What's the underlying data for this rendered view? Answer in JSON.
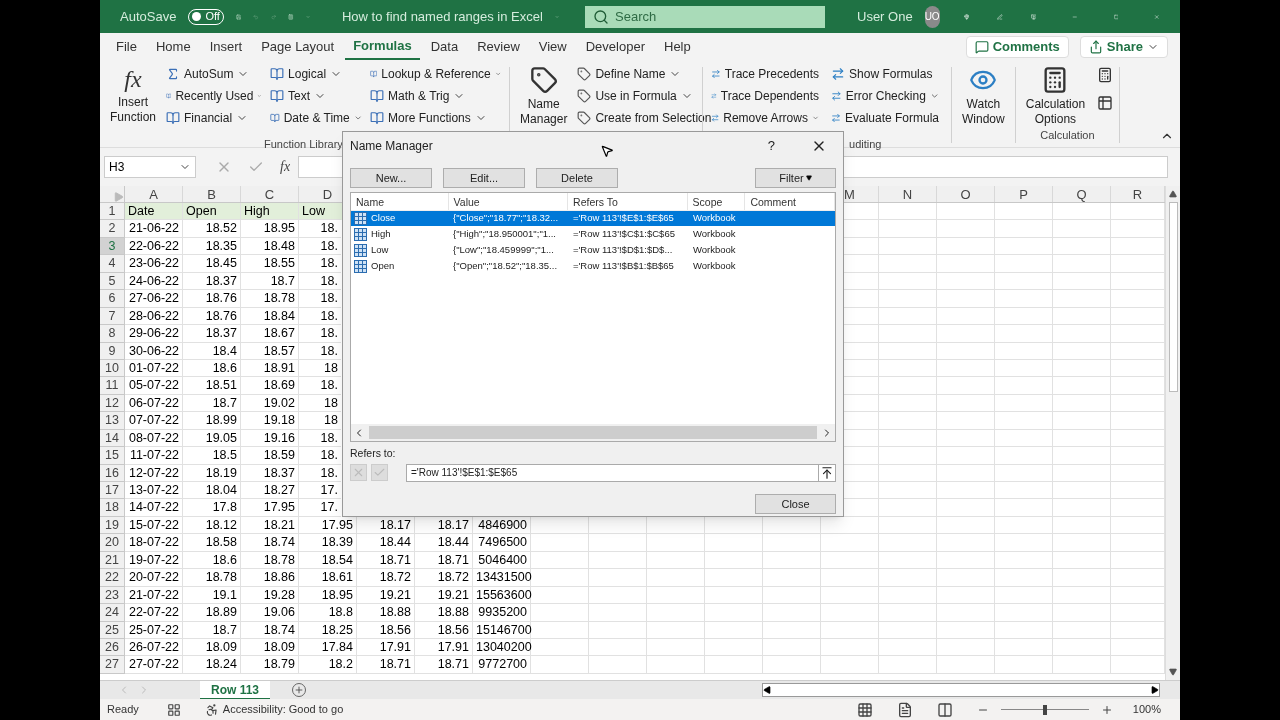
{
  "title_bar": {
    "autosave_label": "AutoSave",
    "autosave_on": false,
    "autosave_state": "Off",
    "document_title": "How to find named ranges in Excel",
    "search_placeholder": "Search",
    "user_name": "User One",
    "user_initials": "UO"
  },
  "menu_tabs": [
    {
      "label": "File",
      "selected": false
    },
    {
      "label": "Home",
      "selected": false
    },
    {
      "label": "Insert",
      "selected": false
    },
    {
      "label": "Page Layout",
      "selected": false
    },
    {
      "label": "Formulas",
      "selected": true
    },
    {
      "label": "Data",
      "selected": false
    },
    {
      "label": "Review",
      "selected": false
    },
    {
      "label": "View",
      "selected": false
    },
    {
      "label": "Developer",
      "selected": false
    },
    {
      "label": "Help",
      "selected": false
    }
  ],
  "comments_button": "Comments",
  "share_button": "Share",
  "ribbon": {
    "insert_function_glyph": "fx",
    "insert_function": [
      "Insert",
      "Function"
    ],
    "function_library": {
      "columns": [
        [
          {
            "label": "AutoSum",
            "dropdown": true
          },
          {
            "label": "Recently Used",
            "dropdown": true
          },
          {
            "label": "Financial",
            "dropdown": true
          }
        ],
        [
          {
            "label": "Logical",
            "dropdown": true
          },
          {
            "label": "Text",
            "dropdown": true
          },
          {
            "label": "Date & Time",
            "dropdown": true
          }
        ],
        [
          {
            "label": "Lookup & Reference",
            "dropdown": true
          },
          {
            "label": "Math & Trig",
            "dropdown": true
          },
          {
            "label": "More Functions",
            "dropdown": true
          }
        ]
      ],
      "group_label": "Function Library"
    },
    "name_manager": [
      "Name",
      "Manager"
    ],
    "defined_names": [
      {
        "label": "Define Name",
        "dropdown": true
      },
      {
        "label": "Use in Formula",
        "dropdown": true
      },
      {
        "label": "Create from Selection",
        "dropdown": false
      }
    ],
    "auditing": {
      "columns": [
        [
          {
            "label": "Trace Precedents",
            "dropdown": false
          },
          {
            "label": "Trace Dependents",
            "dropdown": false
          },
          {
            "label": "Remove Arrows",
            "dropdown": true
          }
        ],
        [
          {
            "label": "Show Formulas",
            "dropdown": false
          },
          {
            "label": "Error Checking",
            "dropdown": true
          },
          {
            "label": "Evaluate Formula",
            "dropdown": false
          }
        ]
      ],
      "group_label": "uditing"
    },
    "watch_window": [
      "Watch",
      "Window"
    ],
    "calculation_options": [
      "Calculation",
      "Options"
    ],
    "calculation_label": "Calculation"
  },
  "formula_bar": {
    "name_box": "H3",
    "fx": "fx"
  },
  "sheet": {
    "columns_left": [
      "A",
      "B",
      "C",
      "D"
    ],
    "columns_right": [
      "M",
      "N",
      "O",
      "P",
      "Q",
      "R"
    ],
    "rows": [
      {
        "number": "1",
        "selected": false,
        "kind": "header",
        "cells": [
          "Date",
          "Open",
          "High",
          "Low"
        ]
      },
      {
        "number": "2",
        "selected": false,
        "kind": "data",
        "cells": [
          "21-06-22",
          "18.52",
          "18.95",
          "18."
        ]
      },
      {
        "number": "3",
        "selected": true,
        "kind": "data",
        "cells": [
          "22-06-22",
          "18.35",
          "18.48",
          "18."
        ]
      },
      {
        "number": "4",
        "selected": false,
        "kind": "data",
        "cells": [
          "23-06-22",
          "18.45",
          "18.55",
          "18."
        ]
      },
      {
        "number": "5",
        "selected": false,
        "kind": "data",
        "cells": [
          "24-06-22",
          "18.37",
          "18.7",
          "18."
        ]
      },
      {
        "number": "6",
        "selected": false,
        "kind": "data",
        "cells": [
          "27-06-22",
          "18.76",
          "18.78",
          "18."
        ]
      },
      {
        "number": "7",
        "selected": false,
        "kind": "data",
        "cells": [
          "28-06-22",
          "18.76",
          "18.84",
          "18."
        ]
      },
      {
        "number": "8",
        "selected": false,
        "kind": "data",
        "cells": [
          "29-06-22",
          "18.37",
          "18.67",
          "18."
        ]
      },
      {
        "number": "9",
        "selected": false,
        "kind": "data",
        "cells": [
          "30-06-22",
          "18.4",
          "18.57",
          "18."
        ]
      },
      {
        "number": "10",
        "selected": false,
        "kind": "data",
        "cells": [
          "01-07-22",
          "18.6",
          "18.91",
          "18"
        ]
      },
      {
        "number": "11",
        "selected": false,
        "kind": "data",
        "cells": [
          "05-07-22",
          "18.51",
          "18.69",
          "18."
        ]
      },
      {
        "number": "12",
        "selected": false,
        "kind": "data",
        "cells": [
          "06-07-22",
          "18.7",
          "19.02",
          "18"
        ]
      },
      {
        "number": "13",
        "selected": false,
        "kind": "data",
        "cells": [
          "07-07-22",
          "18.99",
          "19.18",
          "18"
        ]
      },
      {
        "number": "14",
        "selected": false,
        "kind": "data",
        "cells": [
          "08-07-22",
          "19.05",
          "19.16",
          "18."
        ]
      },
      {
        "number": "15",
        "selected": false,
        "kind": "data",
        "cells": [
          "11-07-22",
          "18.5",
          "18.59",
          "18."
        ]
      },
      {
        "number": "16",
        "selected": false,
        "kind": "data",
        "cells": [
          "12-07-22",
          "18.19",
          "18.37",
          "18."
        ]
      },
      {
        "number": "17",
        "selected": false,
        "kind": "data",
        "cells": [
          "13-07-22",
          "18.04",
          "18.27",
          "17."
        ]
      },
      {
        "number": "18",
        "selected": false,
        "kind": "data",
        "cells": [
          "14-07-22",
          "17.8",
          "17.95",
          "17."
        ]
      },
      {
        "number": "19",
        "selected": false,
        "kind": "data",
        "cells": [
          "15-07-22",
          "18.12",
          "18.21",
          "17.95",
          "18.17",
          "18.17",
          "4846900"
        ]
      },
      {
        "number": "20",
        "selected": false,
        "kind": "data",
        "cells": [
          "18-07-22",
          "18.58",
          "18.74",
          "18.39",
          "18.44",
          "18.44",
          "7496500"
        ]
      },
      {
        "number": "21",
        "selected": false,
        "kind": "data",
        "cells": [
          "19-07-22",
          "18.6",
          "18.78",
          "18.54",
          "18.71",
          "18.71",
          "5046400"
        ]
      },
      {
        "number": "22",
        "selected": false,
        "kind": "data",
        "cells": [
          "20-07-22",
          "18.78",
          "18.86",
          "18.61",
          "18.72",
          "18.72",
          "13431500"
        ]
      },
      {
        "number": "23",
        "selected": false,
        "kind": "data",
        "cells": [
          "21-07-22",
          "19.1",
          "19.28",
          "18.95",
          "19.21",
          "19.21",
          "15563600"
        ]
      },
      {
        "number": "24",
        "selected": false,
        "kind": "data",
        "cells": [
          "22-07-22",
          "18.89",
          "19.06",
          "18.8",
          "18.88",
          "18.88",
          "9935200"
        ]
      },
      {
        "number": "25",
        "selected": false,
        "kind": "data",
        "cells": [
          "25-07-22",
          "18.7",
          "18.74",
          "18.25",
          "18.56",
          "18.56",
          "15146700"
        ]
      },
      {
        "number": "26",
        "selected": false,
        "kind": "data",
        "cells": [
          "26-07-22",
          "18.09",
          "18.09",
          "17.84",
          "17.91",
          "17.91",
          "13040200"
        ]
      },
      {
        "number": "27",
        "selected": false,
        "kind": "data",
        "cells": [
          "27-07-22",
          "18.24",
          "18.79",
          "18.2",
          "18.71",
          "18.71",
          "9772700"
        ]
      }
    ]
  },
  "sheet_tabs": [
    {
      "label": "Row 113",
      "selected": true
    }
  ],
  "status_bar": {
    "ready": "Ready",
    "accessibility": "Accessibility: Good to go",
    "zoom": "100%",
    "zoom_slider": {
      "level": 0.5
    }
  },
  "name_manager": {
    "title": "Name Manager",
    "help": "?",
    "buttons": [
      "New...",
      "Edit...",
      "Delete"
    ],
    "filter_button": "Filter",
    "columns": [
      "Name",
      "Value",
      "Refers To",
      "Scope",
      "Comment"
    ],
    "names": [
      {
        "name": "Close",
        "value": "{\"Close\";\"18.77\";\"18.32...",
        "refers_to": "='Row 113'!$E$1:$E$65",
        "scope": "Workbook",
        "selected": true
      },
      {
        "name": "High",
        "value": "{\"High\";\"18.950001\";\"1...",
        "refers_to": "='Row 113'!$C$1:$C$65",
        "scope": "Workbook",
        "selected": false
      },
      {
        "name": "Low",
        "value": "{\"Low\";\"18.459999\";\"1...",
        "refers_to": "='Row 113'!$D$1:$D$...",
        "scope": "Workbook",
        "selected": false
      },
      {
        "name": "Open",
        "value": "{\"Open\";\"18.52\";\"18.35...",
        "refers_to": "='Row 113'!$B$1:$B$65",
        "scope": "Workbook",
        "selected": false
      }
    ],
    "refers_to_label": "Refers to:",
    "refers_to_value": "='Row 113'!$E$1:$E$65",
    "close_button": "Close"
  }
}
